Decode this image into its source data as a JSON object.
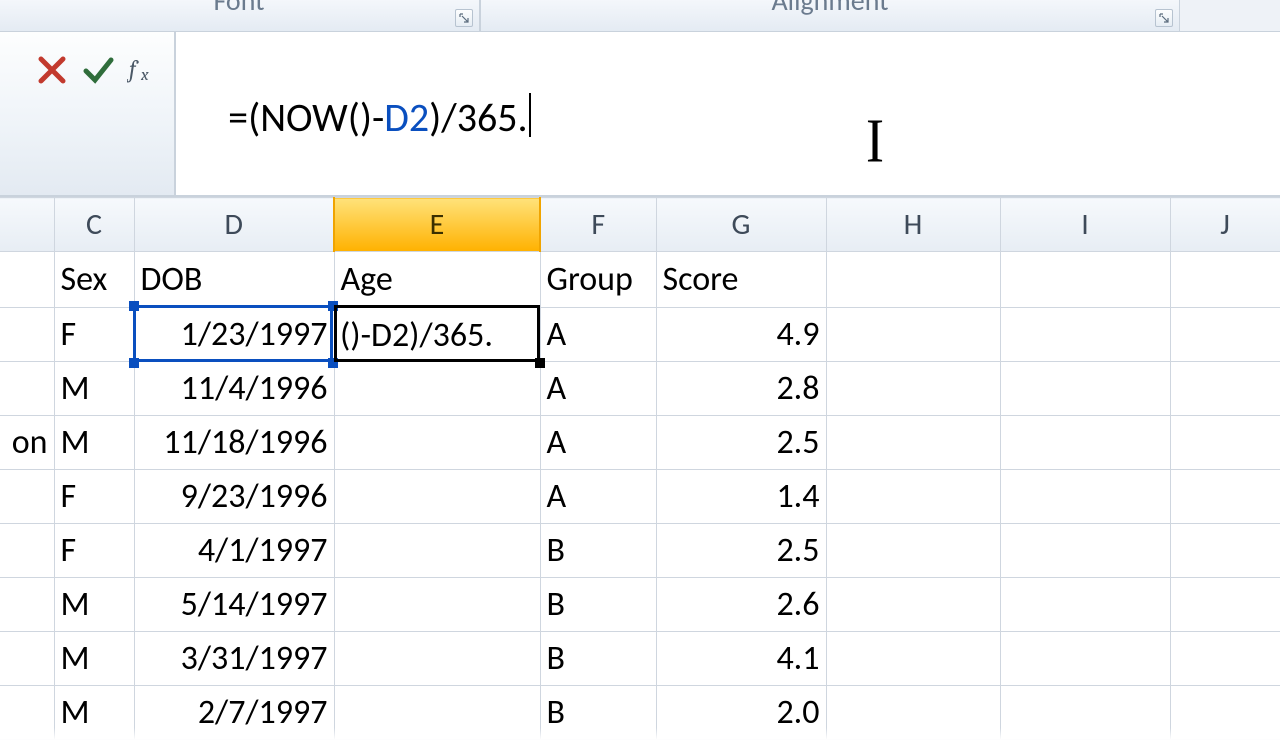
{
  "ribbon": {
    "font_label": "Font",
    "alignment_label": "Alignment"
  },
  "formula_bar": {
    "prefix": "=(",
    "func_name": "NOW",
    "mid1": "()-",
    "cell_ref": "D2",
    "mid2": ")/365.",
    "full_formula": "=(NOW()-D2)/365."
  },
  "columns": {
    "c": "C",
    "d": "D",
    "e": "E",
    "f": "F",
    "g": "G",
    "h": "H",
    "i": "I",
    "j": "J"
  },
  "headers": {
    "b_fragment": "on",
    "sex": "Sex",
    "dob": "DOB",
    "age": "Age",
    "group": "Group",
    "score": "Score"
  },
  "active_cell": {
    "address": "E2",
    "display_text": "()-D2)/365."
  },
  "referenced_cell": "D2",
  "rows": [
    {
      "b": "",
      "sex": "F",
      "dob": "1/23/1997",
      "age": "",
      "group": "A",
      "score": "4.9"
    },
    {
      "b": "",
      "sex": "M",
      "dob": "11/4/1996",
      "age": "",
      "group": "A",
      "score": "2.8"
    },
    {
      "b": "on",
      "sex": "M",
      "dob": "11/18/1996",
      "age": "",
      "group": "A",
      "score": "2.5"
    },
    {
      "b": "",
      "sex": "F",
      "dob": "9/23/1996",
      "age": "",
      "group": "A",
      "score": "1.4"
    },
    {
      "b": "",
      "sex": "F",
      "dob": "4/1/1997",
      "age": "",
      "group": "B",
      "score": "2.5"
    },
    {
      "b": "",
      "sex": "M",
      "dob": "5/14/1997",
      "age": "",
      "group": "B",
      "score": "2.6"
    },
    {
      "b": "",
      "sex": "M",
      "dob": "3/31/1997",
      "age": "",
      "group": "B",
      "score": "4.1"
    }
  ],
  "partial_row": {
    "sex": "M",
    "dob": "2/7/1997",
    "group": "B",
    "score": "2.0"
  }
}
